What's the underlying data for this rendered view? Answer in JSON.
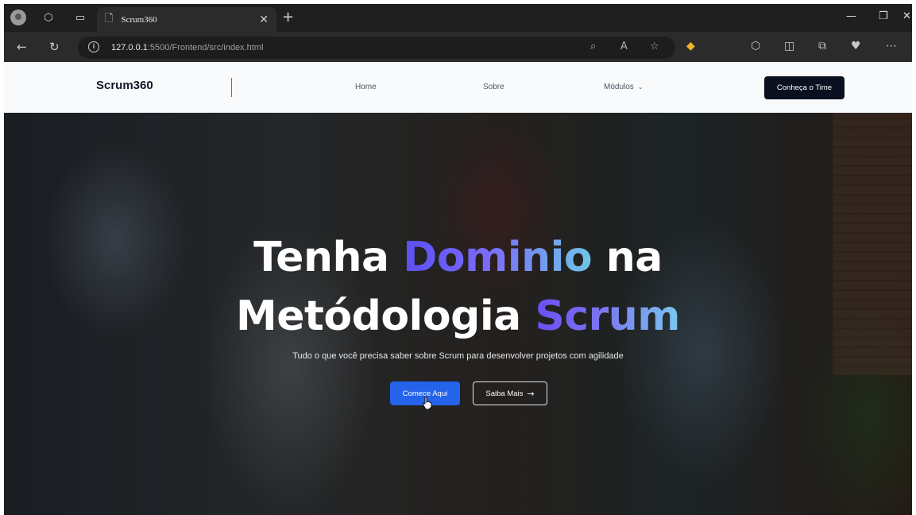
{
  "browser": {
    "tab_title": "Scrum360",
    "url_host": "127.0.0.1",
    "url_rest": ":5500/Frontend/src/index.html"
  },
  "site": {
    "logo": "Scrum360",
    "nav": [
      "Home",
      "Sobre",
      "Módulos"
    ],
    "cta": "Conheça o Time"
  },
  "hero": {
    "line1_a": "Tenha ",
    "line1_b": "Dominio",
    "line1_c": " na",
    "line2_a": "Metódologia ",
    "line2_b": "Scrum",
    "subtitle": "Tudo o que você precisa saber sobre Scrum para desenvolver projetos com agilidade",
    "primary_button": "Comece Aqui",
    "secondary_button": "Saiba Mais"
  }
}
